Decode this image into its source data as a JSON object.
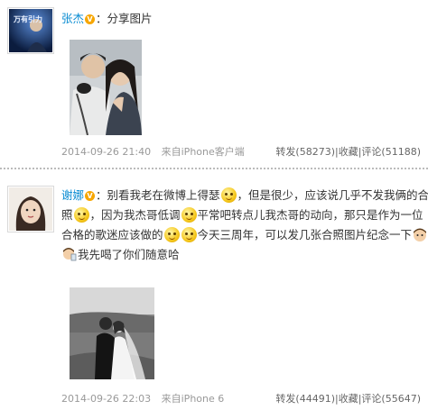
{
  "posts": [
    {
      "author": "张杰",
      "text": "：分享图片",
      "avatar_caption": "万有引力",
      "time": "2014-09-26 21:40",
      "source": "来自iPhone客户端",
      "repost": "转发(58273)",
      "favorite": "收藏",
      "comment": "评论(51188)"
    },
    {
      "author": "谢娜",
      "lines": [
        {
          "before": "：别看我老在微博上得瑟",
          "after": "，但是很少，应该说几乎不发我俩的合"
        },
        {
          "before": "照",
          "after": "，因为我杰哥低调",
          "after2": "平常吧转点儿我杰哥的动向，那只是作为一位"
        },
        {
          "before": "合格的歌迷应该做的",
          "after": "今天三周年，可以发几张合照图片纪念一下"
        },
        {
          "before": "我先喝了你们随意哈"
        }
      ],
      "time": "2014-09-26 22:03",
      "source": "来自iPhone 6",
      "repost": "转发(44491)",
      "favorite": "收藏",
      "comment": "评论(55647)"
    }
  ],
  "colors": {
    "name": "#0a8cd2",
    "meta": "#999999",
    "divider": "#bbbbbb",
    "vbadge": "#f7a600"
  }
}
